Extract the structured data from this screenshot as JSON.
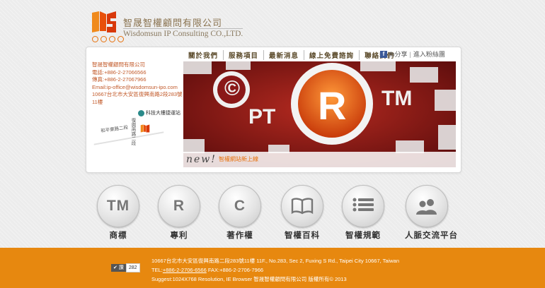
{
  "logo": {
    "name_cn": "智晟智權顧問有限公司",
    "name_en": "Wisdomsun IP Consulting CO.,LTD."
  },
  "nav": {
    "items": [
      "關於我們",
      "服務項目",
      "最新消息",
      "線上免費諮詢",
      "聯絡我們"
    ]
  },
  "fb": {
    "share_label": "fb分享",
    "fans_label": "進入粉絲團"
  },
  "contact": {
    "company": "智晟智權顧問有限公司",
    "phone": "電話:+886-2-27066566",
    "fax": "傳真:+886-2-27067966",
    "email": "Email:ip-office@wisdomsun-ipo.com",
    "address": "10667台北市大安區復興南路2段283號11樓"
  },
  "map": {
    "station": "科技大樓捷運站",
    "road1": "和平東路二段",
    "road2": "復興南路二段"
  },
  "banner": {
    "new_label": "new!",
    "news": "智權網站新上線",
    "symbols": [
      "©",
      "PT",
      "R",
      "TM"
    ]
  },
  "services": [
    {
      "icon_text": "TM",
      "label": "商標",
      "icon": "tm-icon"
    },
    {
      "icon_text": "R",
      "label": "專利",
      "icon": "r-icon"
    },
    {
      "icon_text": "C",
      "label": "著作權",
      "icon": "c-icon"
    },
    {
      "icon_text": "",
      "label": "智權百科",
      "icon": "book-icon"
    },
    {
      "icon_text": "",
      "label": "智權規範",
      "icon": "list-icon"
    },
    {
      "icon_text": "",
      "label": "人脈交流平台",
      "icon": "people-icon"
    }
  ],
  "footer": {
    "share_label": "讚",
    "share_count": "282",
    "address": "10667台北市大安區復興南路二段283號11樓 11F., No.283, Sec 2, Fuxing S Rd., Taipei City 10667, Taiwan",
    "tel_prefix": "TEL:",
    "tel": "+886-2-2706-6566",
    "fax": " FAX:+886-2-2706-7966",
    "copyright": "Suggest:1024X768 Resolution, IE Browser    智晟智權顧問有限公司 版權所有© 2013"
  },
  "colors": {
    "accent": "#e8700a",
    "footer": "#e7880f",
    "banner": "#8a1818"
  }
}
